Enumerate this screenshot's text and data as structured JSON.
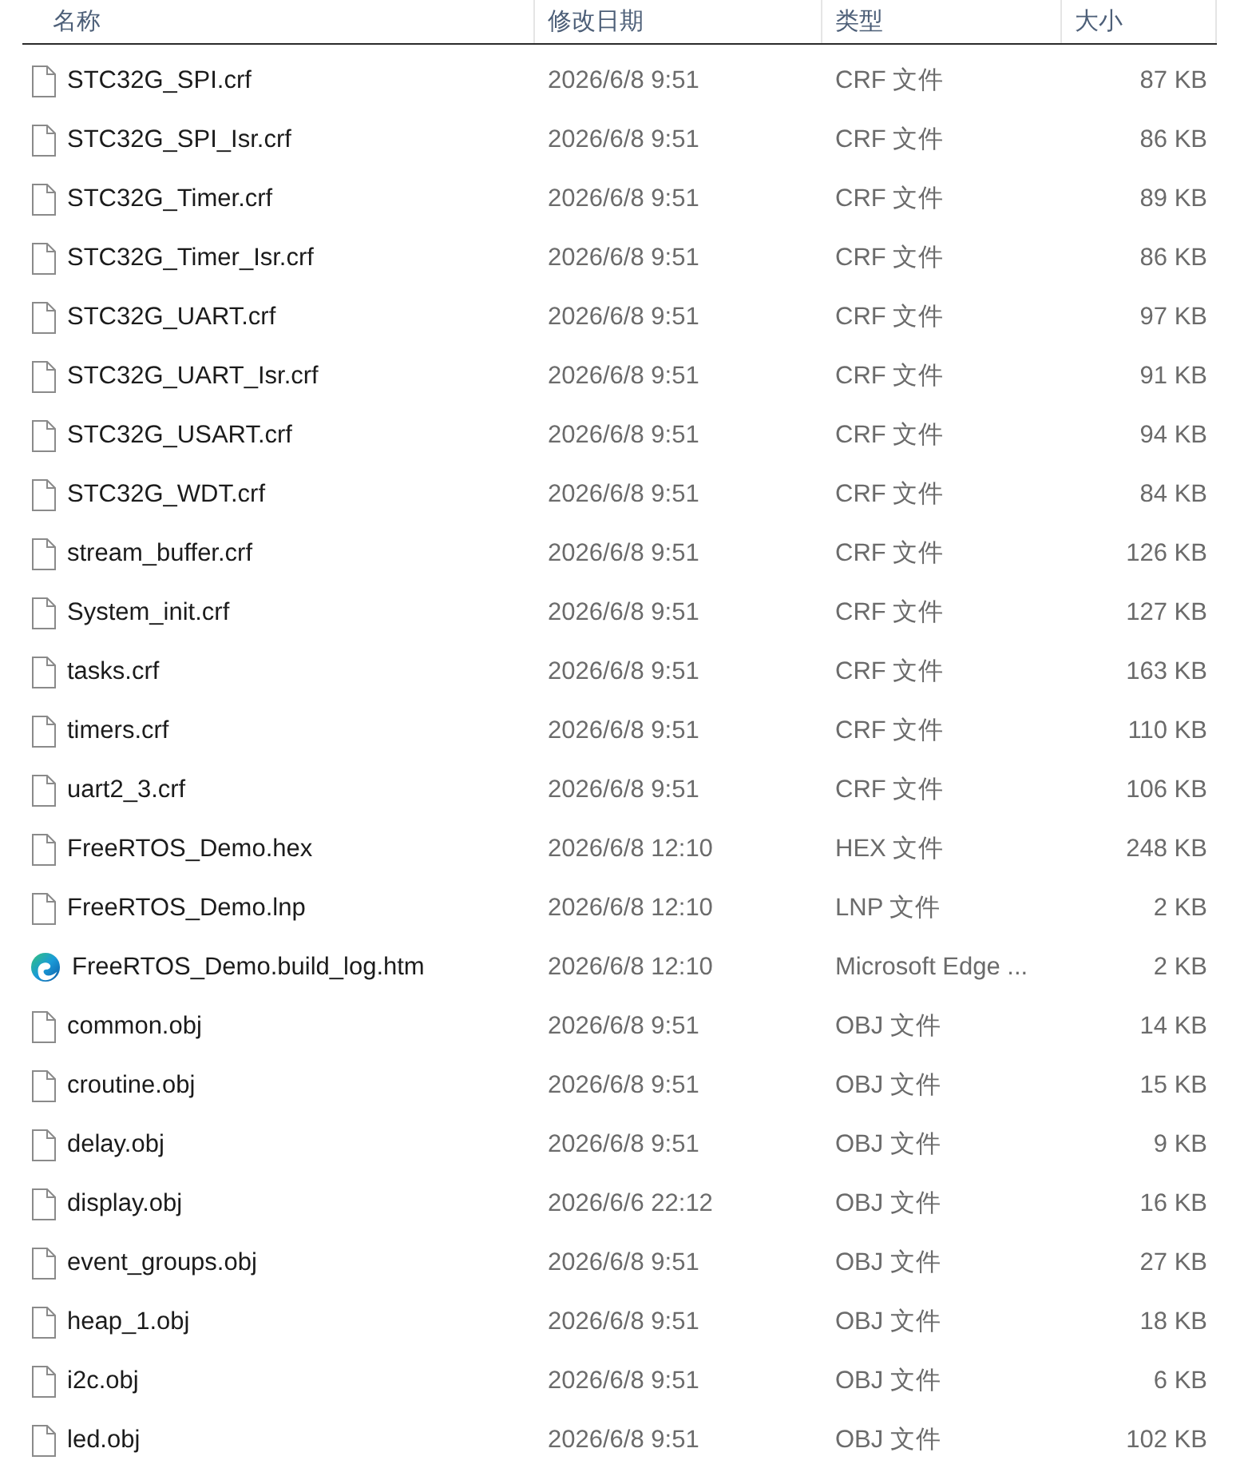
{
  "columns": [
    {
      "label": "名称"
    },
    {
      "label": "修改日期"
    },
    {
      "label": "类型"
    },
    {
      "label": "大小"
    }
  ],
  "files": [
    {
      "kind": "file",
      "name": "STC32G_SPI.crf",
      "modified": "2026/6/8 9:51",
      "type": "CRF 文件",
      "size": "87 KB"
    },
    {
      "kind": "file",
      "name": "STC32G_SPI_Isr.crf",
      "modified": "2026/6/8 9:51",
      "type": "CRF 文件",
      "size": "86 KB"
    },
    {
      "kind": "file",
      "name": "STC32G_Timer.crf",
      "modified": "2026/6/8 9:51",
      "type": "CRF 文件",
      "size": "89 KB"
    },
    {
      "kind": "file",
      "name": "STC32G_Timer_Isr.crf",
      "modified": "2026/6/8 9:51",
      "type": "CRF 文件",
      "size": "86 KB"
    },
    {
      "kind": "file",
      "name": "STC32G_UART.crf",
      "modified": "2026/6/8 9:51",
      "type": "CRF 文件",
      "size": "97 KB"
    },
    {
      "kind": "file",
      "name": "STC32G_UART_Isr.crf",
      "modified": "2026/6/8 9:51",
      "type": "CRF 文件",
      "size": "91 KB"
    },
    {
      "kind": "file",
      "name": "STC32G_USART.crf",
      "modified": "2026/6/8 9:51",
      "type": "CRF 文件",
      "size": "94 KB"
    },
    {
      "kind": "file",
      "name": "STC32G_WDT.crf",
      "modified": "2026/6/8 9:51",
      "type": "CRF 文件",
      "size": "84 KB"
    },
    {
      "kind": "file",
      "name": "stream_buffer.crf",
      "modified": "2026/6/8 9:51",
      "type": "CRF 文件",
      "size": "126 KB"
    },
    {
      "kind": "file",
      "name": "System_init.crf",
      "modified": "2026/6/8 9:51",
      "type": "CRF 文件",
      "size": "127 KB"
    },
    {
      "kind": "file",
      "name": "tasks.crf",
      "modified": "2026/6/8 9:51",
      "type": "CRF 文件",
      "size": "163 KB"
    },
    {
      "kind": "file",
      "name": "timers.crf",
      "modified": "2026/6/8 9:51",
      "type": "CRF 文件",
      "size": "110 KB"
    },
    {
      "kind": "file",
      "name": "uart2_3.crf",
      "modified": "2026/6/8 9:51",
      "type": "CRF 文件",
      "size": "106 KB"
    },
    {
      "kind": "file",
      "name": "FreeRTOS_Demo.hex",
      "modified": "2026/6/8 12:10",
      "type": "HEX 文件",
      "size": "248 KB"
    },
    {
      "kind": "file",
      "name": "FreeRTOS_Demo.lnp",
      "modified": "2026/6/8 12:10",
      "type": "LNP 文件",
      "size": "2 KB"
    },
    {
      "kind": "browser",
      "name": "FreeRTOS_Demo.build_log.htm",
      "modified": "2026/6/8 12:10",
      "type": "Microsoft Edge ...",
      "size": "2 KB"
    },
    {
      "kind": "file",
      "name": "common.obj",
      "modified": "2026/6/8 9:51",
      "type": "OBJ 文件",
      "size": "14 KB"
    },
    {
      "kind": "file",
      "name": "croutine.obj",
      "modified": "2026/6/8 9:51",
      "type": "OBJ 文件",
      "size": "15 KB"
    },
    {
      "kind": "file",
      "name": "delay.obj",
      "modified": "2026/6/8 9:51",
      "type": "OBJ 文件",
      "size": "9 KB"
    },
    {
      "kind": "file",
      "name": "display.obj",
      "modified": "2026/6/6 22:12",
      "type": "OBJ 文件",
      "size": "16 KB"
    },
    {
      "kind": "file",
      "name": "event_groups.obj",
      "modified": "2026/6/8 9:51",
      "type": "OBJ 文件",
      "size": "27 KB"
    },
    {
      "kind": "file",
      "name": "heap_1.obj",
      "modified": "2026/6/8 9:51",
      "type": "OBJ 文件",
      "size": "18 KB"
    },
    {
      "kind": "file",
      "name": "i2c.obj",
      "modified": "2026/6/8 9:51",
      "type": "OBJ 文件",
      "size": "6 KB"
    },
    {
      "kind": "file",
      "name": "led.obj",
      "modified": "2026/6/8 9:51",
      "type": "OBJ 文件",
      "size": "102 KB"
    }
  ]
}
